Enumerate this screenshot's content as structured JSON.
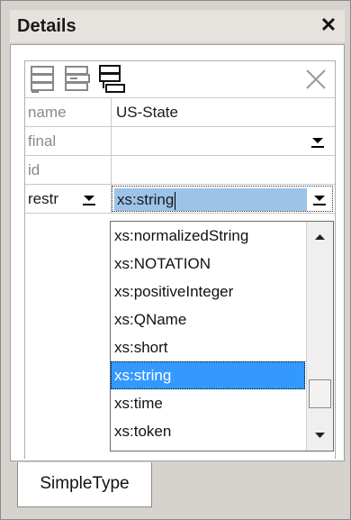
{
  "window": {
    "title": "Details",
    "close_glyph": "✕"
  },
  "toolbar": {
    "buttons": [
      {
        "icon": "append-row-icon"
      },
      {
        "icon": "insert-row-icon"
      },
      {
        "icon": "add-child-row-icon"
      },
      {
        "icon": "delete-row-icon"
      }
    ]
  },
  "properties": [
    {
      "name": "name",
      "value": "US-State"
    },
    {
      "name": "final",
      "value": ""
    },
    {
      "name": "id",
      "value": ""
    },
    {
      "name": "restr",
      "value": "xs:string"
    }
  ],
  "dropdown": {
    "options": [
      "xs:normalizedString",
      "xs:NOTATION",
      "xs:positiveInteger",
      "xs:QName",
      "xs:short",
      "xs:string",
      "xs:time",
      "xs:token"
    ],
    "selected": "xs:string"
  },
  "tabs": [
    {
      "label": "SimpleType"
    }
  ],
  "colors": {
    "selection": "#3399ff",
    "input_highlight": "#9cc3e8"
  }
}
